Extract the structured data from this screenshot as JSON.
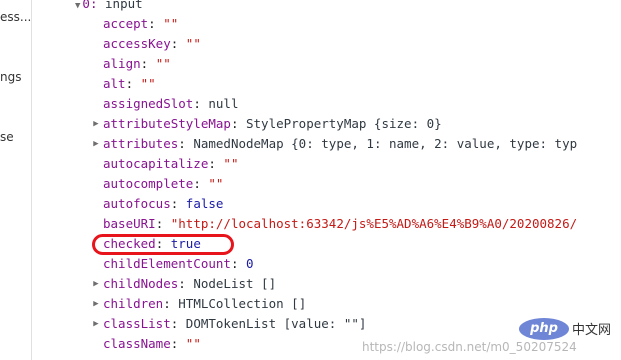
{
  "sidebar": {
    "items": [
      {
        "label": "ess..."
      },
      {
        "label": "ngs"
      },
      {
        "label": "se"
      }
    ]
  },
  "tree": {
    "root": {
      "index": "0:",
      "type": "input"
    },
    "props": [
      {
        "key": "accept",
        "value": "\"\"",
        "kind": "str",
        "expandable": false
      },
      {
        "key": "accessKey",
        "value": "\"\"",
        "kind": "str",
        "expandable": false
      },
      {
        "key": "align",
        "value": "\"\"",
        "kind": "str",
        "expandable": false
      },
      {
        "key": "alt",
        "value": "\"\"",
        "kind": "str",
        "expandable": false
      },
      {
        "key": "assignedSlot",
        "value": "null",
        "kind": "obj",
        "expandable": false
      },
      {
        "key": "attributeStyleMap",
        "value": "StylePropertyMap {size: 0}",
        "kind": "obj",
        "expandable": true
      },
      {
        "key": "attributes",
        "value": "NamedNodeMap {0: type, 1: name, 2: value, type: typ",
        "kind": "obj",
        "expandable": true
      },
      {
        "key": "autocapitalize",
        "value": "\"\"",
        "kind": "str",
        "expandable": false
      },
      {
        "key": "autocomplete",
        "value": "\"\"",
        "kind": "str",
        "expandable": false
      },
      {
        "key": "autofocus",
        "value": "false",
        "kind": "kw",
        "expandable": false
      },
      {
        "key": "baseURI",
        "value": "\"http://localhost:63342/js%E5%AD%A6%E4%B9%A0/20200826/",
        "kind": "str",
        "expandable": false
      },
      {
        "key": "checked",
        "value": "true",
        "kind": "kw",
        "expandable": false
      },
      {
        "key": "childElementCount",
        "value": "0",
        "kind": "num",
        "expandable": false
      },
      {
        "key": "childNodes",
        "value": "NodeList []",
        "kind": "obj",
        "expandable": true
      },
      {
        "key": "children",
        "value": "HTMLCollection []",
        "kind": "obj",
        "expandable": true
      },
      {
        "key": "classList",
        "value": "DOMTokenList [value: \"\"]",
        "kind": "obj",
        "expandable": true
      },
      {
        "key": "className",
        "value": "\"\"",
        "kind": "str",
        "expandable": false
      }
    ]
  },
  "watermark": {
    "logo": "php",
    "site": "中文网",
    "url": "https://blog.csdn.net/m0_50207524"
  },
  "colors": {
    "highlight": "#e8141b",
    "key": "#881391",
    "string": "#c41a16",
    "keyword": "#1a1aa6"
  },
  "icons": {
    "expanded": "triangle-down-icon",
    "collapsed": "triangle-right-icon"
  }
}
